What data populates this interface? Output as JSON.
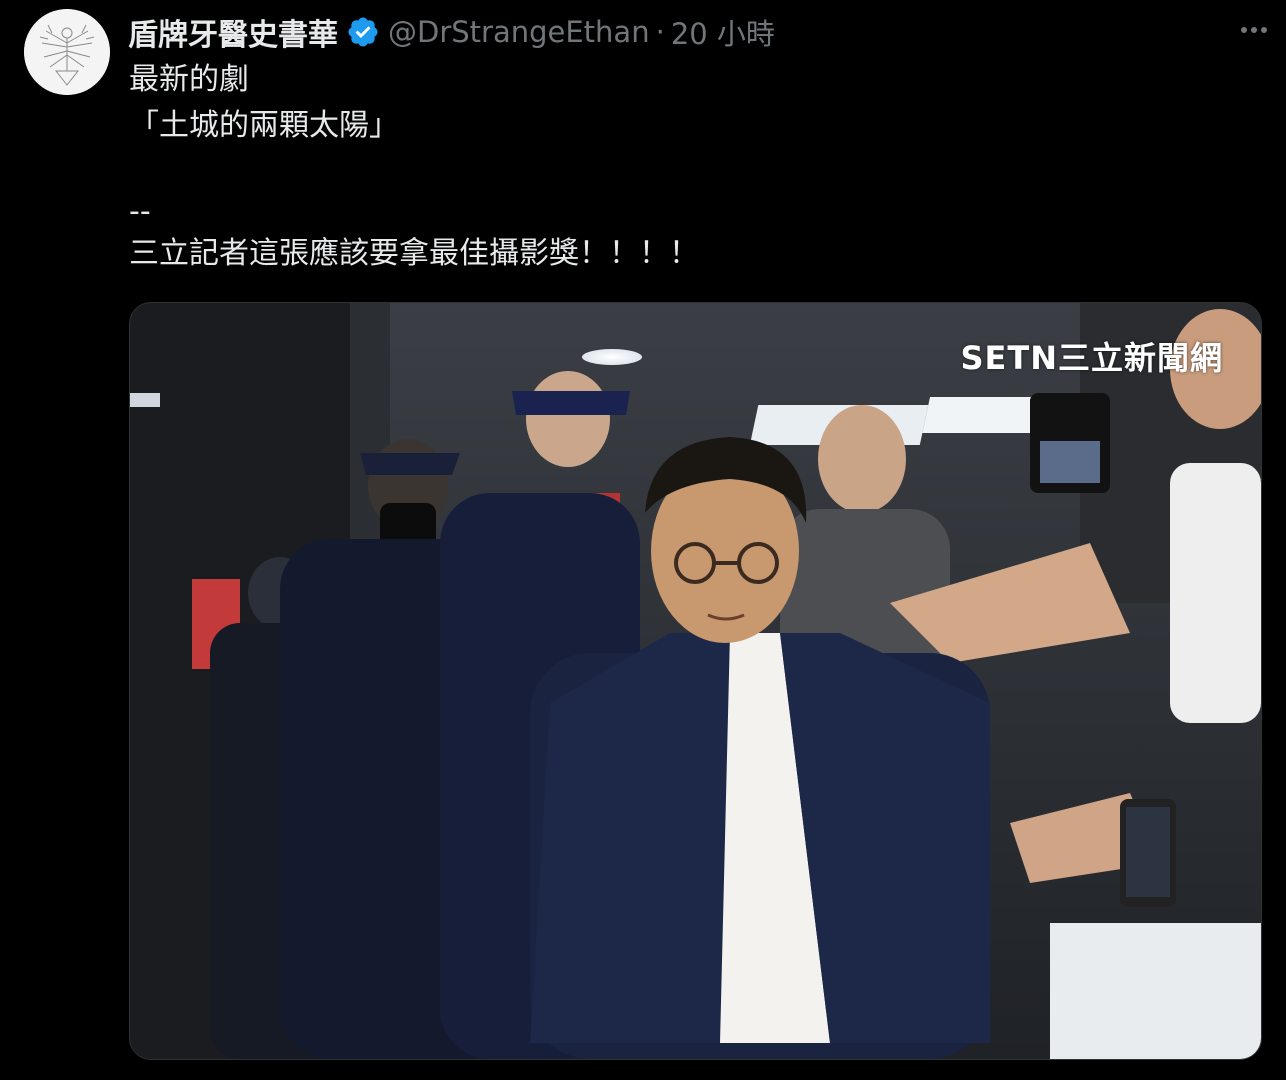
{
  "author": {
    "display_name": "盾牌牙醫史書華",
    "handle": "@DrStrangeEthan",
    "separator": "·",
    "timestamp": "20 小時",
    "verified": true
  },
  "icons": {
    "verified": "verified-badge-icon",
    "more": "more-horizontal-icon",
    "avatar": "avatar"
  },
  "tweet": {
    "lines": [
      "最新的劇",
      "「土城的兩顆太陽」",
      "--",
      "三立記者這張應該要拿最佳攝影獎！！！！"
    ]
  },
  "media": {
    "watermark": "SETN三立新聞網"
  },
  "colors": {
    "background": "#000000",
    "text": "#e7e9ea",
    "secondary": "#71767b",
    "verified": "#1d9bf0"
  }
}
